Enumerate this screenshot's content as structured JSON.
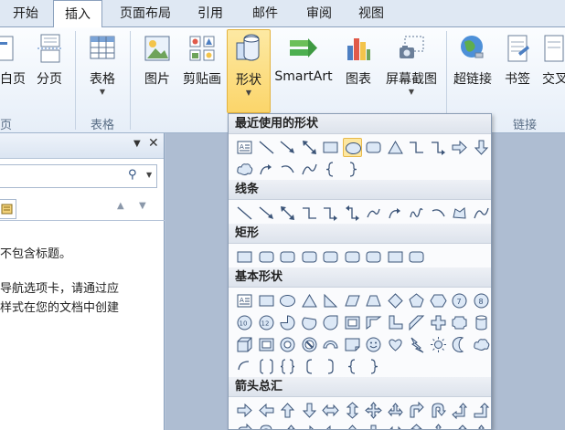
{
  "tabs": [
    {
      "label": "开始"
    },
    {
      "label": "插入"
    },
    {
      "label": "页面布局"
    },
    {
      "label": "引用"
    },
    {
      "label": "邮件"
    },
    {
      "label": "审阅"
    },
    {
      "label": "视图"
    }
  ],
  "ribbon": {
    "buttons": {
      "cover_page": "白页",
      "page_break": "分页",
      "table": "表格",
      "picture": "图片",
      "clipart": "剪贴画",
      "shapes": "形状",
      "smartart": "SmartArt",
      "chart": "图表",
      "screenshot": "屏幕截图",
      "hyperlink": "超链接",
      "bookmark": "书签",
      "crossref": "交叉"
    },
    "groups": {
      "pages": "页",
      "tables": "表格",
      "links": "链接"
    }
  },
  "pane": {
    "search_icon": "search-icon",
    "text_line1": "不包含标题。",
    "text_line2": "导航选项卡，请通过应",
    "text_line3": "样式在您的文档中创建"
  },
  "shapes_menu": {
    "categories": {
      "recent": "最近使用的形状",
      "lines": "线条",
      "rectangles": "矩形",
      "basic": "基本形状",
      "arrows": "箭头总汇"
    }
  },
  "colors": {
    "accent": "#fbd56a",
    "ribbon_bg": "#e6eef8",
    "shape_stroke": "#3b5478",
    "shape_fill": "#dce8f6"
  }
}
